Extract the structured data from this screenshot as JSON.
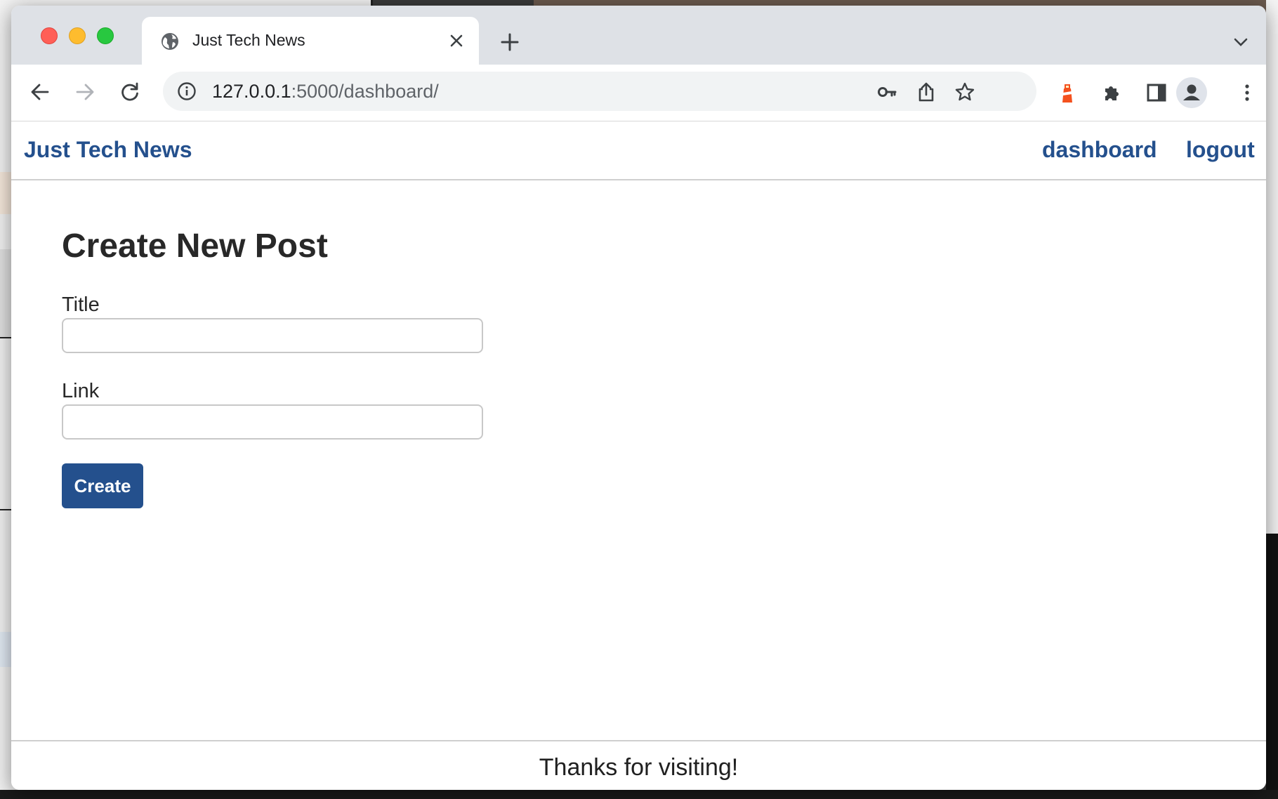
{
  "browser": {
    "tab_title": "Just Tech News",
    "url_host": "127.0.0.1",
    "url_path": ":5000/dashboard/"
  },
  "icons": {
    "tab_favicon": "globe-icon",
    "tab_close": "close-icon",
    "new_tab": "plus-icon",
    "tab_search": "chevron-down-icon",
    "back": "arrow-left-icon",
    "forward": "arrow-right-icon",
    "reload": "reload-icon",
    "site_info": "info-icon",
    "password": "key-icon",
    "share": "share-icon",
    "bookmark": "star-icon",
    "extension_lighthouse": "lighthouse-icon",
    "extensions": "puzzle-icon",
    "side_panel": "side-panel-icon",
    "profile": "profile-icon",
    "menu": "kebab-menu-icon"
  },
  "site": {
    "brand": "Just Tech News",
    "nav": {
      "dashboard": "dashboard",
      "logout": "logout"
    }
  },
  "form": {
    "heading": "Create New Post",
    "title_label": "Title",
    "title_value": "",
    "link_label": "Link",
    "link_value": "",
    "submit_label": "Create"
  },
  "footer": {
    "text": "Thanks for visiting!"
  },
  "colors": {
    "accent": "#24508d",
    "lighthouse": "#f4511e"
  }
}
